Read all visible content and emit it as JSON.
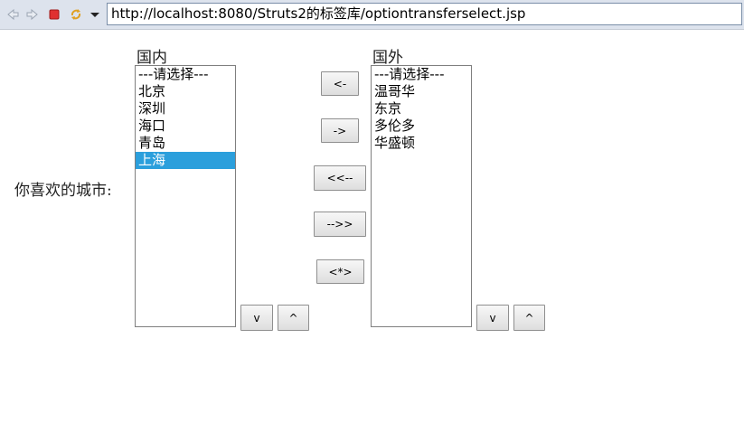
{
  "browser": {
    "url": "http://localhost:8080/Struts2的标签库/optiontransferselect.jsp",
    "icons": [
      "back-arrow-icon",
      "forward-arrow-icon",
      "stop-icon",
      "refresh-icon",
      "dropdown-arrow-icon"
    ]
  },
  "form": {
    "label": "你喜欢的城市:",
    "left_list": {
      "title": "国内",
      "options": [
        "---请选择---",
        "北京",
        "深圳",
        "海口",
        "青岛",
        "上海"
      ],
      "selected": "上海",
      "down_button": "v",
      "up_button": "^"
    },
    "right_list": {
      "title": "国外",
      "options": [
        "---请选择---",
        "温哥华",
        "东京",
        "多伦多",
        "华盛顿"
      ],
      "down_button": "v",
      "up_button": "^"
    },
    "transfer_buttons": {
      "move_left": "<-",
      "move_right": "->",
      "move_all_left": "<<--",
      "move_all_right": "-->>",
      "swap_all": "<*>"
    }
  },
  "colors": {
    "selection": "#2b9fdc",
    "toolbar": "#dde3ed",
    "stop_icon": "#e03030"
  }
}
